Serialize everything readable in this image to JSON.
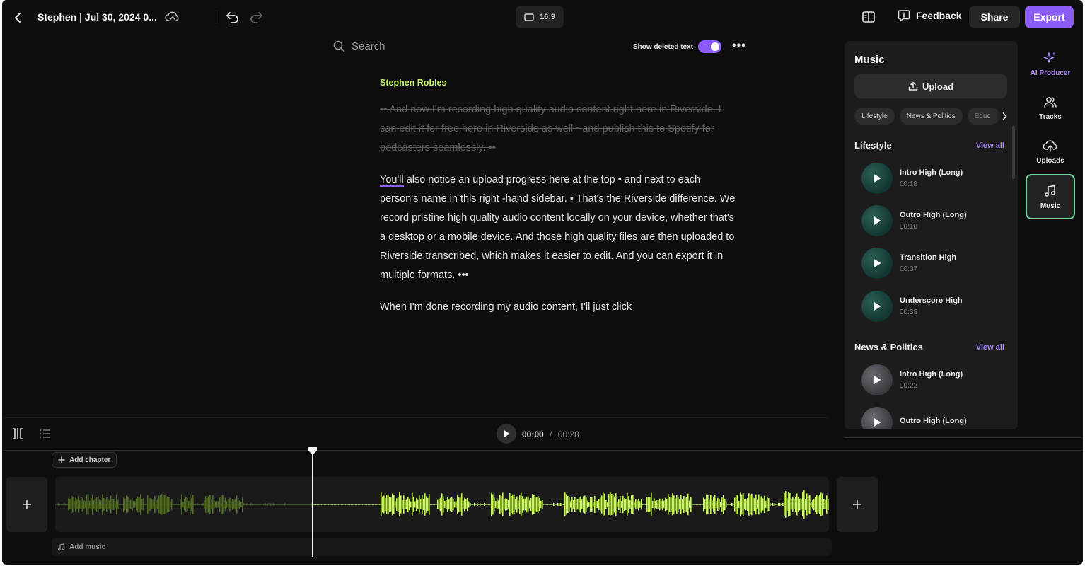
{
  "topbar": {
    "title": "Stephen | Jul 30, 2024 0...",
    "aspect_ratio": "16:9",
    "feedback_label": "Feedback",
    "share_label": "Share",
    "export_label": "Export"
  },
  "transcript": {
    "search_placeholder": "Search",
    "show_deleted_label": "Show deleted text",
    "show_deleted_on": true,
    "speaker": "Stephen Robles",
    "deleted_paragraph": "•• And now I'm recording high quality audio content right here in Riverside. I can edit it for free here in Riverside as well • and publish this to Spotify for podcasters seamlessly. ••",
    "paragraph_first_word": "You'll",
    "paragraph_rest": " also notice an upload progress here at the top • and next to each person's name in this right -hand sidebar. • That's the Riverside difference. We record pristine high quality audio content locally on your device, whether that's a desktop or a mobile device. And those high quality files are then uploaded to Riverside transcribed, which makes it easier to edit. And you can export it in multiple formats. •••",
    "paragraph_last": "When I'm done recording my audio content, I'll just click"
  },
  "music_panel": {
    "title": "Music",
    "upload_label": "Upload",
    "categories": [
      "Lifestyle",
      "News & Politics",
      "Educ"
    ],
    "sections": [
      {
        "title": "Lifestyle",
        "view_all": "View all",
        "tracks": [
          {
            "name": "Intro High (Long)",
            "duration": "00:18"
          },
          {
            "name": "Outro High (Long)",
            "duration": "00:18"
          },
          {
            "name": "Transition High",
            "duration": "00:07"
          },
          {
            "name": "Underscore High",
            "duration": "00:33"
          }
        ]
      },
      {
        "title": "News & Politics",
        "view_all": "View all",
        "tracks": [
          {
            "name": "Intro High (Long)",
            "duration": "00:22"
          },
          {
            "name": "Outro High (Long)",
            "duration": ""
          }
        ]
      }
    ]
  },
  "sidebar": {
    "items": [
      {
        "label": "AI Producer",
        "icon": "sparkles-icon"
      },
      {
        "label": "Tracks",
        "icon": "people-icon"
      },
      {
        "label": "Uploads",
        "icon": "cloud-upload-icon"
      },
      {
        "label": "Music",
        "icon": "music-note-icon",
        "active": true
      }
    ]
  },
  "player": {
    "current_time": "00:00",
    "separator": "/",
    "total_time": "00:28"
  },
  "timeline": {
    "add_chapter_label": "Add chapter",
    "add_music_label": "Add music"
  },
  "colors": {
    "accent": "#8b5cf6",
    "speaker": "#c7f36b",
    "waveform": "#c9f56a",
    "waveform_dim": "#4f6a2a",
    "active_outline": "#6ddba3"
  }
}
